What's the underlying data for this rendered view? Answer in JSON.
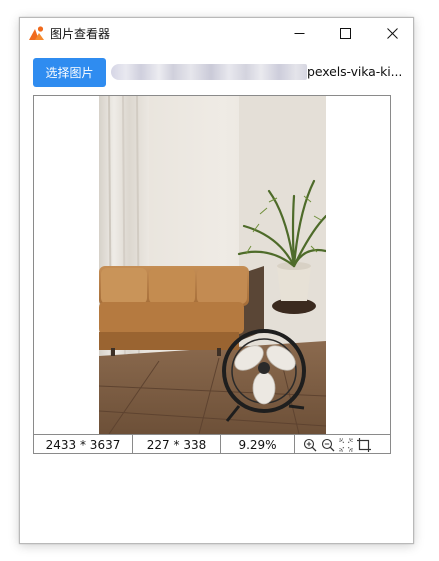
{
  "window": {
    "title": "图片查看器"
  },
  "toolbar": {
    "choose_label": "选择图片",
    "path_visible": "pexels-vika-ki..."
  },
  "status": {
    "original_size": "2433 * 3637",
    "display_size": "227 * 338",
    "zoom": "9.29%"
  },
  "icons": [
    "app-icon",
    "minimize-icon",
    "maximize-icon",
    "close-icon",
    "zoom-in-icon",
    "zoom-out-icon",
    "fit-screen-icon",
    "crop-icon"
  ],
  "colors": {
    "accent": "#2f8cf0",
    "app_icon_orange": "#f06a1d"
  }
}
